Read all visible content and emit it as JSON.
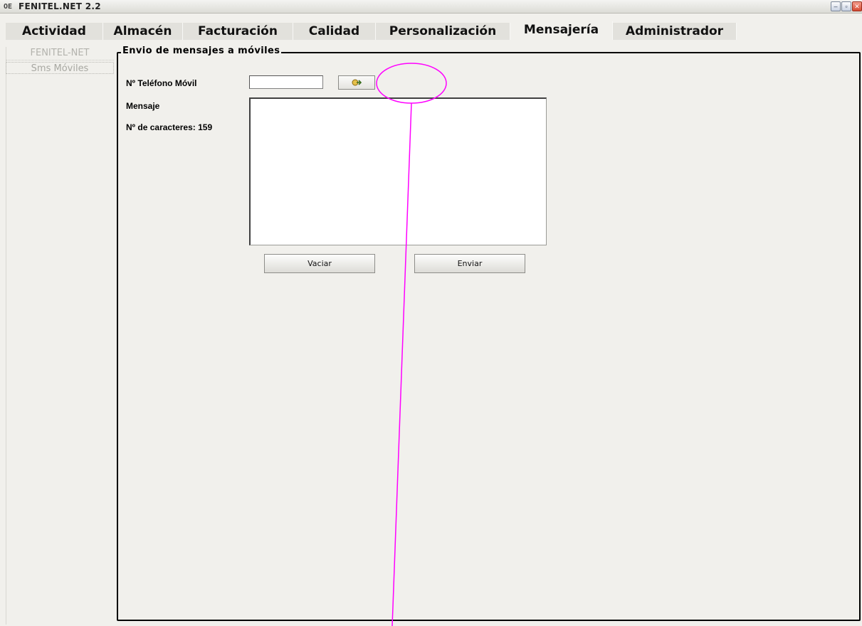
{
  "window": {
    "app_icon": "OE",
    "title": "FENITEL.NET 2.2",
    "controls": {
      "minimize": "–",
      "restore": "▫",
      "close": "✕"
    }
  },
  "tabs": [
    {
      "label": "Actividad",
      "active": false
    },
    {
      "label": "Almacén",
      "active": false
    },
    {
      "label": "Facturación",
      "active": false
    },
    {
      "label": "Calidad",
      "active": false
    },
    {
      "label": "Personalización",
      "active": false
    },
    {
      "label": "Mensajería",
      "active": true
    },
    {
      "label": "Administrador",
      "active": false
    }
  ],
  "sidebar": {
    "header": "FENITEL-NET",
    "items": [
      {
        "label": "Sms Móviles"
      }
    ]
  },
  "form": {
    "group_title": "Envio de mensajes a móviles",
    "phone_label": "Nº Teléfono Móvil",
    "phone_value": "",
    "lookup_icon": "contacts-lookup-icon",
    "message_label": "Mensaje",
    "char_count_label": "Nº de caracteres: 159",
    "message_value": "",
    "clear_button": "Vaciar",
    "send_button": "Enviar"
  },
  "annotation": {
    "color": "#ff00ff",
    "shape": "ellipse-with-pointer-line"
  }
}
